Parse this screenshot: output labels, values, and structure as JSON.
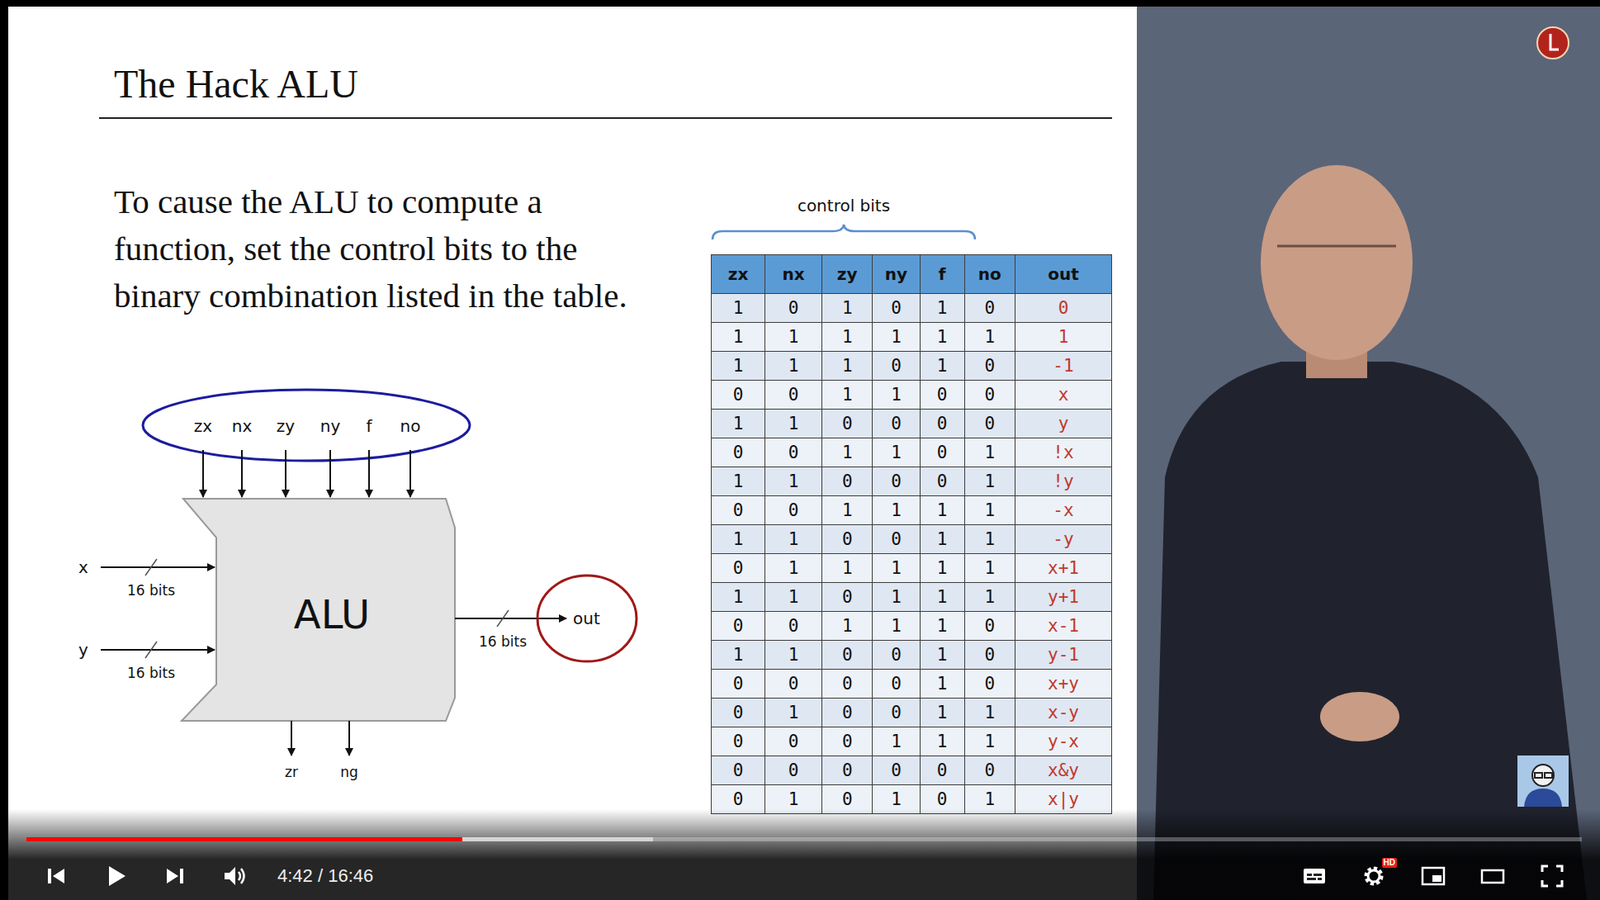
{
  "player": {
    "time": "4:42 / 16:46",
    "paused": true,
    "progress": 0.28,
    "buffered": 0.403,
    "hd_badge": "HD"
  },
  "slide": {
    "title": "The Hack ALU",
    "text": "To cause the ALU to compute a function, set the control bits to the binary combination listed in the table.",
    "diagram": {
      "control_inputs": [
        "zx",
        "nx",
        "zy",
        "ny",
        "f",
        "no"
      ],
      "inputs": [
        {
          "name": "x",
          "width": "16 bits"
        },
        {
          "name": "y",
          "width": "16 bits"
        }
      ],
      "block": "ALU",
      "output": {
        "name": "out",
        "width": "16 bits"
      },
      "flags": [
        "zr",
        "ng"
      ]
    },
    "table": {
      "brace_label": "control bits",
      "columns": [
        "zx",
        "nx",
        "zy",
        "ny",
        "f",
        "no",
        "out"
      ],
      "rows": [
        [
          "1",
          "0",
          "1",
          "0",
          "1",
          "0",
          "0"
        ],
        [
          "1",
          "1",
          "1",
          "1",
          "1",
          "1",
          "1"
        ],
        [
          "1",
          "1",
          "1",
          "0",
          "1",
          "0",
          "-1"
        ],
        [
          "0",
          "0",
          "1",
          "1",
          "0",
          "0",
          "x"
        ],
        [
          "1",
          "1",
          "0",
          "0",
          "0",
          "0",
          "y"
        ],
        [
          "0",
          "0",
          "1",
          "1",
          "0",
          "1",
          "!x"
        ],
        [
          "1",
          "1",
          "0",
          "0",
          "0",
          "1",
          "!y"
        ],
        [
          "0",
          "0",
          "1",
          "1",
          "1",
          "1",
          "-x"
        ],
        [
          "1",
          "1",
          "0",
          "0",
          "1",
          "1",
          "-y"
        ],
        [
          "0",
          "1",
          "1",
          "1",
          "1",
          "1",
          "x+1"
        ],
        [
          "1",
          "1",
          "0",
          "1",
          "1",
          "1",
          "y+1"
        ],
        [
          "0",
          "0",
          "1",
          "1",
          "1",
          "0",
          "x-1"
        ],
        [
          "1",
          "1",
          "0",
          "0",
          "1",
          "0",
          "y-1"
        ],
        [
          "0",
          "0",
          "0",
          "0",
          "1",
          "0",
          "x+y"
        ],
        [
          "0",
          "1",
          "0",
          "0",
          "1",
          "1",
          "x-y"
        ],
        [
          "0",
          "0",
          "0",
          "1",
          "1",
          "1",
          "y-x"
        ],
        [
          "0",
          "0",
          "0",
          "0",
          "0",
          "0",
          "x&y"
        ],
        [
          "0",
          "1",
          "0",
          "1",
          "0",
          "1",
          "x|y"
        ]
      ]
    }
  }
}
